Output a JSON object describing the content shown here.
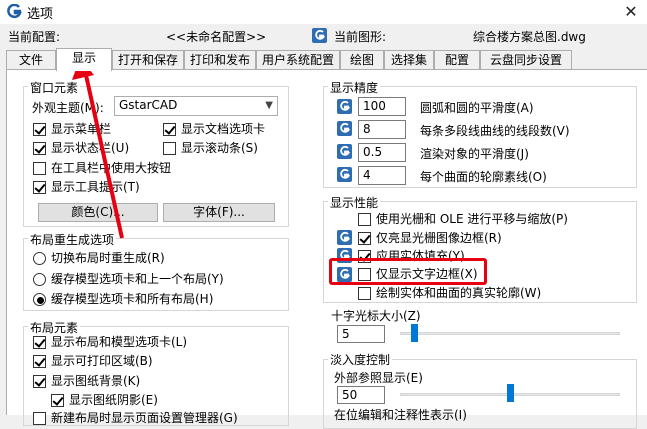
{
  "window": {
    "title": "选项",
    "close_glyph": "✕"
  },
  "header": {
    "current_config_label": "当前配置:",
    "current_config_value": "<<未命名配置>>",
    "current_drawing_label": "当前图形:",
    "current_drawing_value": "综合楼方案总图.dwg"
  },
  "tabs": [
    "文件",
    "显示",
    "打开和保存",
    "打印和发布",
    "用户系统配置",
    "绘图",
    "选择集",
    "配置",
    "云盘同步设置"
  ],
  "window_elements": {
    "title": "窗口元素",
    "theme_label": "外观主题(M):",
    "theme_value": "GstarCAD",
    "checks": [
      {
        "label": "显示菜单栏",
        "checked": true
      },
      {
        "label": "显示文档选项卡",
        "checked": true
      },
      {
        "label": "显示状态栏(U)",
        "checked": true
      },
      {
        "label": "显示滚动条(S)",
        "checked": false
      },
      {
        "label": "在工具栏中使用大按钮",
        "checked": false
      },
      {
        "label": "显示工具提示(T)",
        "checked": true
      }
    ],
    "color_button": "颜色(C)...",
    "font_button": "字体(F)..."
  },
  "layout_regen": {
    "title": "布局重生成选项",
    "options": [
      {
        "label": "切换布局时重生成(R)",
        "selected": false
      },
      {
        "label": "缓存模型选项卡和上一个布局(Y)",
        "selected": false
      },
      {
        "label": "缓存模型选项卡和所有布局(H)",
        "selected": true
      }
    ]
  },
  "layout_elements": {
    "title": "布局元素",
    "checks": [
      {
        "label": "显示布局和模型选项卡(L)",
        "checked": true
      },
      {
        "label": "显示可打印区域(B)",
        "checked": true
      },
      {
        "label": "显示图纸背景(K)",
        "checked": true
      },
      {
        "label": "显示图纸阴影(E)",
        "checked": true
      },
      {
        "label": "新建布局时显示页面设置管理器(G)",
        "checked": false
      }
    ]
  },
  "display_precision": {
    "title": "显示精度",
    "rows": [
      {
        "value": "100",
        "label": "圆弧和圆的平滑度(A)"
      },
      {
        "value": "8",
        "label": "每条多段线曲线的线段数(V)"
      },
      {
        "value": "0.5",
        "label": "渲染对象的平滑度(J)"
      },
      {
        "value": "4",
        "label": "每个曲面的轮廓素线(O)"
      }
    ]
  },
  "display_performance": {
    "title": "显示性能",
    "checks": [
      {
        "label": "使用光栅和 OLE 进行平移与缩放(P)",
        "checked": false
      },
      {
        "label": "仅亮显光栅图像边框(R)",
        "checked": true
      },
      {
        "label": "应用实体填充(Y)",
        "checked": true
      },
      {
        "label": "仅显示文字边框(X)",
        "checked": false
      },
      {
        "label": "绘制实体和曲面的真实轮廓(W)",
        "checked": false
      }
    ]
  },
  "crosshair": {
    "title": "十字光标大小(Z)",
    "value": "5",
    "level_fraction": 0.05
  },
  "fade": {
    "title": "淡入度控制",
    "xref_label": "外部参照显示(E)",
    "xref_value": "50",
    "xref_fraction": 0.5,
    "inplace_label": "在位编辑和注释性表示(I)"
  },
  "colors": {
    "highlight": "#e60012",
    "slider_thumb": "#0078d7",
    "logo_blue": "#1f5fa8"
  }
}
